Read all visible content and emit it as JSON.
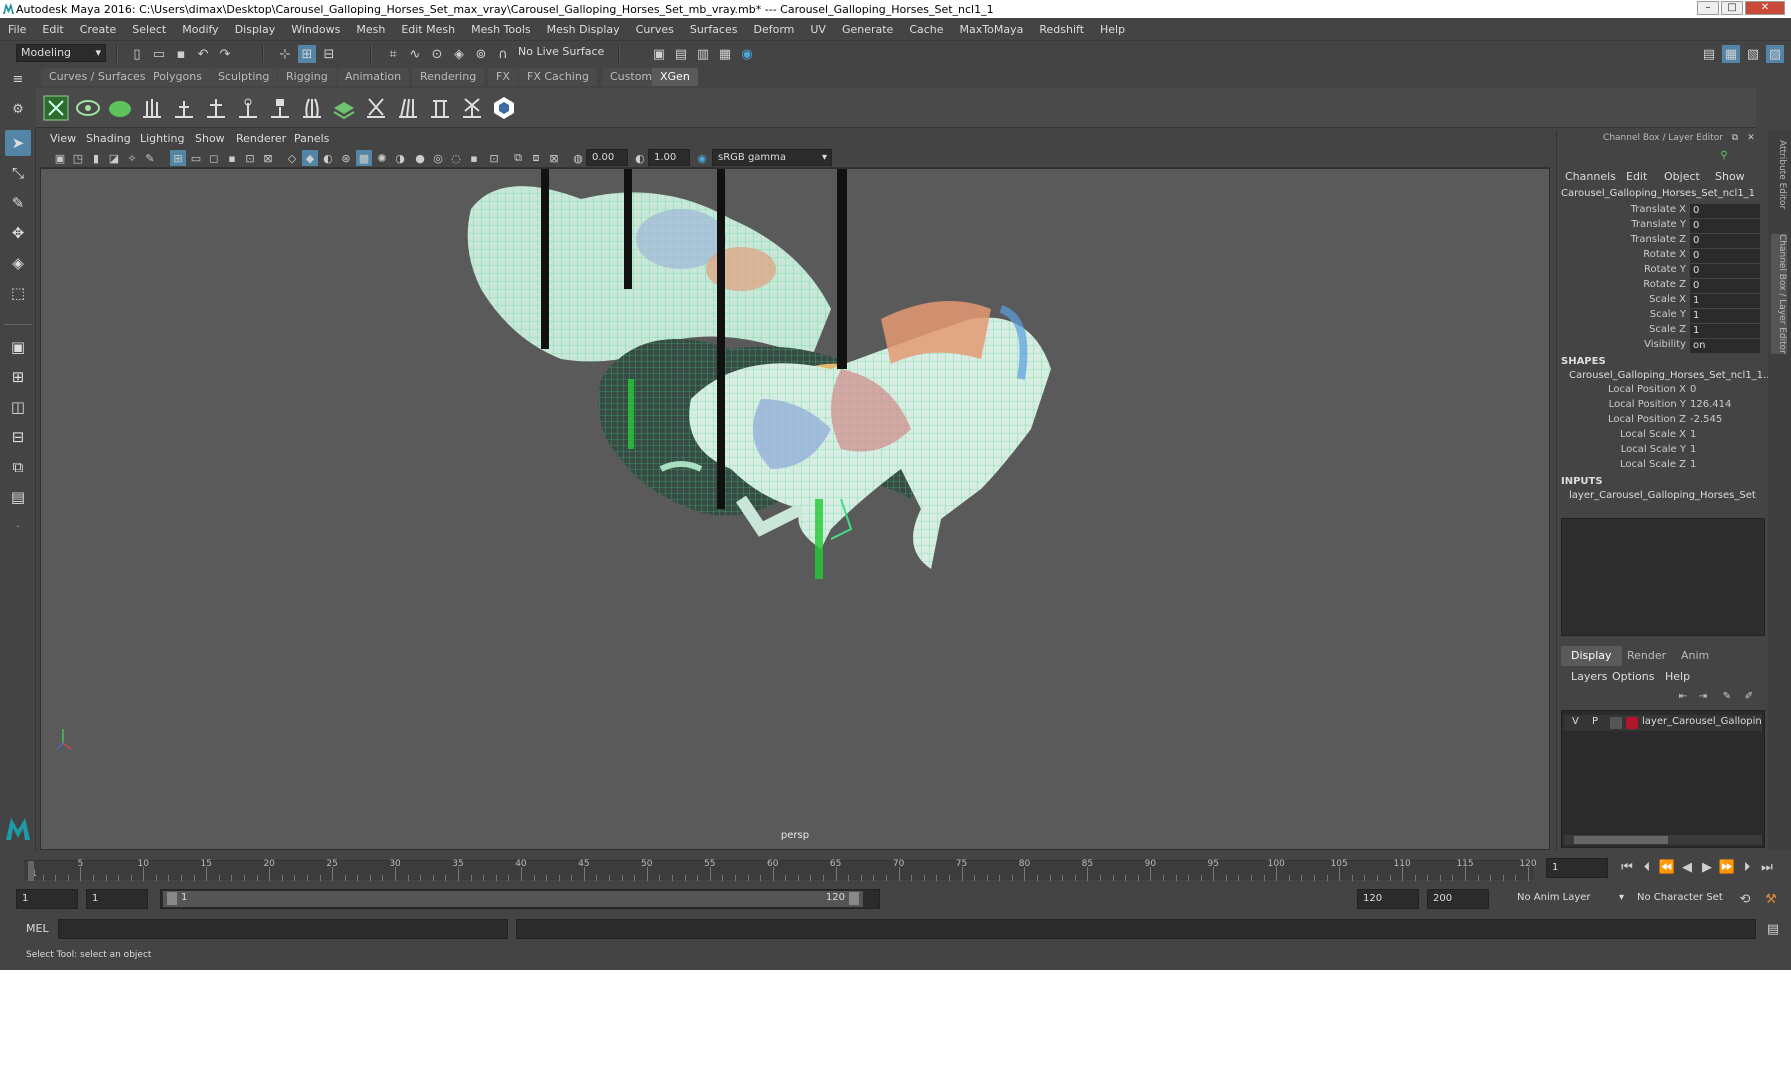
{
  "window": {
    "title": "Autodesk Maya 2016: C:\\Users\\dimax\\Desktop\\Carousel_Galloping_Horses_Set_max_vray\\Carousel_Galloping_Horses_Set_mb_vray.mb*   ---   Carousel_Galloping_Horses_Set_ncl1_1"
  },
  "menubar": [
    "File",
    "Edit",
    "Create",
    "Select",
    "Modify",
    "Display",
    "Windows",
    "Mesh",
    "Edit Mesh",
    "Mesh Tools",
    "Mesh Display",
    "Curves",
    "Surfaces",
    "Deform",
    "UV",
    "Generate",
    "Cache",
    "MaxToMaya",
    "Redshift",
    "Help"
  ],
  "statusline": {
    "mode": "Modeling",
    "live_surface": "No Live Surface"
  },
  "shelf_tabs": [
    "Curves / Surfaces",
    "Polygons",
    "Sculpting",
    "Rigging",
    "Animation",
    "Rendering",
    "FX",
    "FX Caching",
    "Custom",
    "XGen"
  ],
  "shelf_active": "XGen",
  "viewport": {
    "menus": [
      "View",
      "Shading",
      "Lighting",
      "Show",
      "Renderer",
      "Panels"
    ],
    "exposure": "0.00",
    "gamma": "1.00",
    "color_space": "sRGB gamma",
    "camera_label": "persp"
  },
  "channel_box": {
    "title": "Channel Box / Layer Editor",
    "menus": [
      "Channels",
      "Edit",
      "Object",
      "Show"
    ],
    "object_name": "Carousel_Galloping_Horses_Set_ncl1_1",
    "attributes": [
      {
        "name": "Translate X",
        "value": "0"
      },
      {
        "name": "Translate Y",
        "value": "0"
      },
      {
        "name": "Translate Z",
        "value": "0"
      },
      {
        "name": "Rotate X",
        "value": "0"
      },
      {
        "name": "Rotate Y",
        "value": "0"
      },
      {
        "name": "Rotate Z",
        "value": "0"
      },
      {
        "name": "Scale X",
        "value": "1"
      },
      {
        "name": "Scale Y",
        "value": "1"
      },
      {
        "name": "Scale Z",
        "value": "1"
      },
      {
        "name": "Visibility",
        "value": "on"
      }
    ],
    "shapes_header": "SHAPES",
    "shape_name": "Carousel_Galloping_Horses_Set_ncl1_1...",
    "shape_attributes": [
      {
        "name": "Local Position X",
        "value": "0"
      },
      {
        "name": "Local Position Y",
        "value": "126.414"
      },
      {
        "name": "Local Position Z",
        "value": "-2.545"
      },
      {
        "name": "Local Scale X",
        "value": "1"
      },
      {
        "name": "Local Scale Y",
        "value": "1"
      },
      {
        "name": "Local Scale Z",
        "value": "1"
      }
    ],
    "inputs_header": "INPUTS",
    "input_name": "layer_Carousel_Galloping_Horses_Set"
  },
  "layer_editor": {
    "tabs": [
      "Display",
      "Render",
      "Anim"
    ],
    "menus": [
      "Layers",
      "Options",
      "Help"
    ],
    "layer": {
      "v": "V",
      "p": "P",
      "name": "layer_Carousel_Gallopin",
      "color": "#b0182a"
    }
  },
  "side_tabs": [
    "Attribute Editor",
    "Channel Box / Layer Editor"
  ],
  "timeline": {
    "ticks": [
      "1",
      "5",
      "10",
      "15",
      "20",
      "25",
      "30",
      "35",
      "40",
      "45",
      "50",
      "55",
      "60",
      "65",
      "70",
      "75",
      "80",
      "85",
      "90",
      "95",
      "100",
      "105",
      "110",
      "115",
      "120"
    ],
    "current_frame": "1"
  },
  "range": {
    "start": "1",
    "inner_start": "1",
    "slider_start": "1",
    "slider_end": "120",
    "end": "120",
    "max_end": "200",
    "anim_layer": "No Anim Layer",
    "character_set": "No Character Set"
  },
  "command": {
    "label": "MEL"
  },
  "help_line": "Select Tool: select an object"
}
